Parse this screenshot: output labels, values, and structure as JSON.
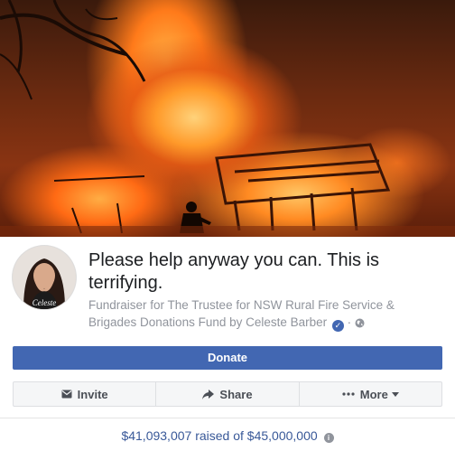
{
  "fundraiser": {
    "title": "Please help anyway you can. This is terrifying.",
    "subtitle": "Fundraiser for The Trustee for NSW Rural Fire Service & Brigades Donations Fund by Celeste Barber",
    "subtitle_suffix": " ·",
    "avatar_signature": "Celeste",
    "raised_text": "$41,093,007 raised of $45,000,000"
  },
  "buttons": {
    "donate": "Donate",
    "invite": "Invite",
    "share": "Share",
    "more": "More"
  },
  "icons": {
    "verified": "verified-badge-icon",
    "globe": "globe-public-icon",
    "invite": "envelope-icon",
    "share": "share-arrow-icon",
    "more": "ellipsis-icon",
    "more_caret": "caret-down-icon",
    "info": "info-icon"
  },
  "colors": {
    "accent": "#4267b2",
    "link": "#385898",
    "muted": "#90949c"
  }
}
